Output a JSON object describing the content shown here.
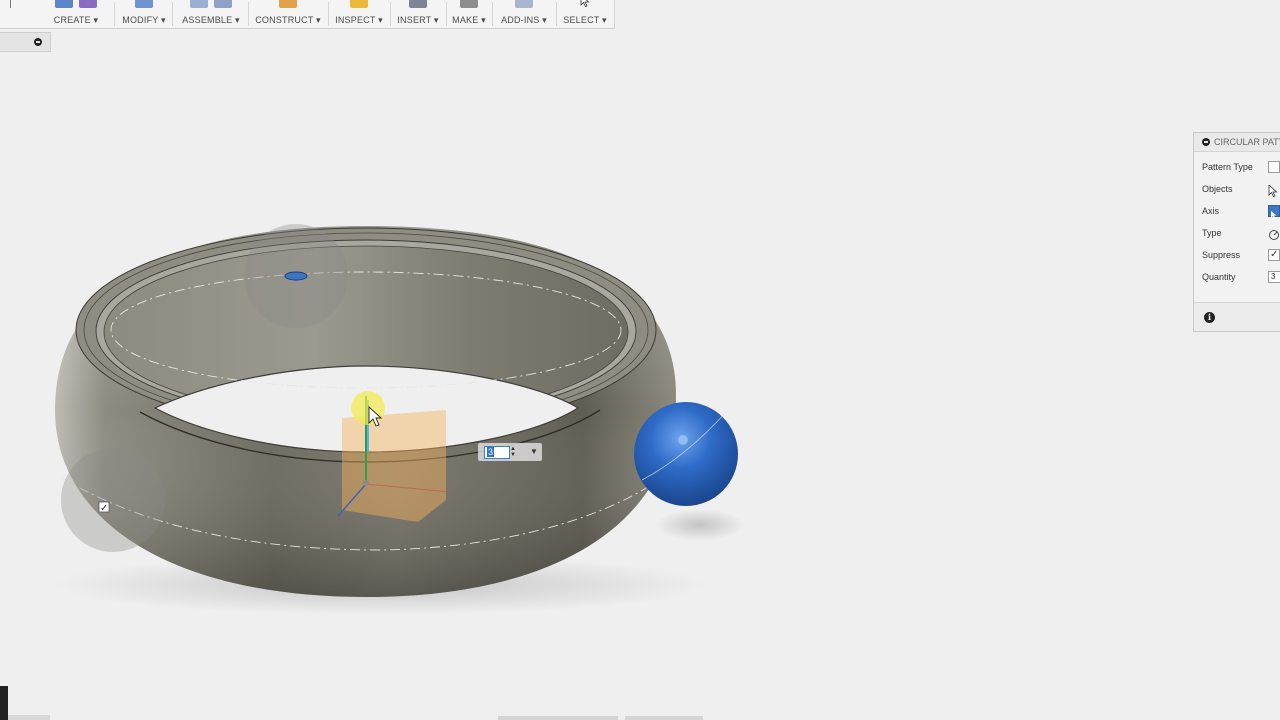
{
  "toolbar": {
    "menus": [
      {
        "label": "CREATE ▾"
      },
      {
        "label": "MODIFY ▾"
      },
      {
        "label": "ASSEMBLE ▾"
      },
      {
        "label": "CONSTRUCT ▾"
      },
      {
        "label": "INSPECT ▾"
      },
      {
        "label": "INSERT ▾"
      },
      {
        "label": "MAKE ▾"
      },
      {
        "label": "ADD-INS ▾"
      },
      {
        "label": "SELECT ▾"
      }
    ]
  },
  "viewport": {
    "quantity_input": "3",
    "checkbox_mark": "✓"
  },
  "dialog": {
    "title": "CIRCULAR PATT",
    "rows": [
      {
        "label": "Pattern Type"
      },
      {
        "label": "Objects"
      },
      {
        "label": "Axis"
      },
      {
        "label": "Type"
      },
      {
        "label": "Suppress",
        "check": "✓"
      },
      {
        "label": "Quantity",
        "value": "3"
      }
    ],
    "info_icon": "i"
  },
  "colors": {
    "ring_dark": "#6a675c",
    "ring_light": "#a8a69c",
    "sphere": "#2f6bc7",
    "accent_blue": "#3d76c4"
  }
}
